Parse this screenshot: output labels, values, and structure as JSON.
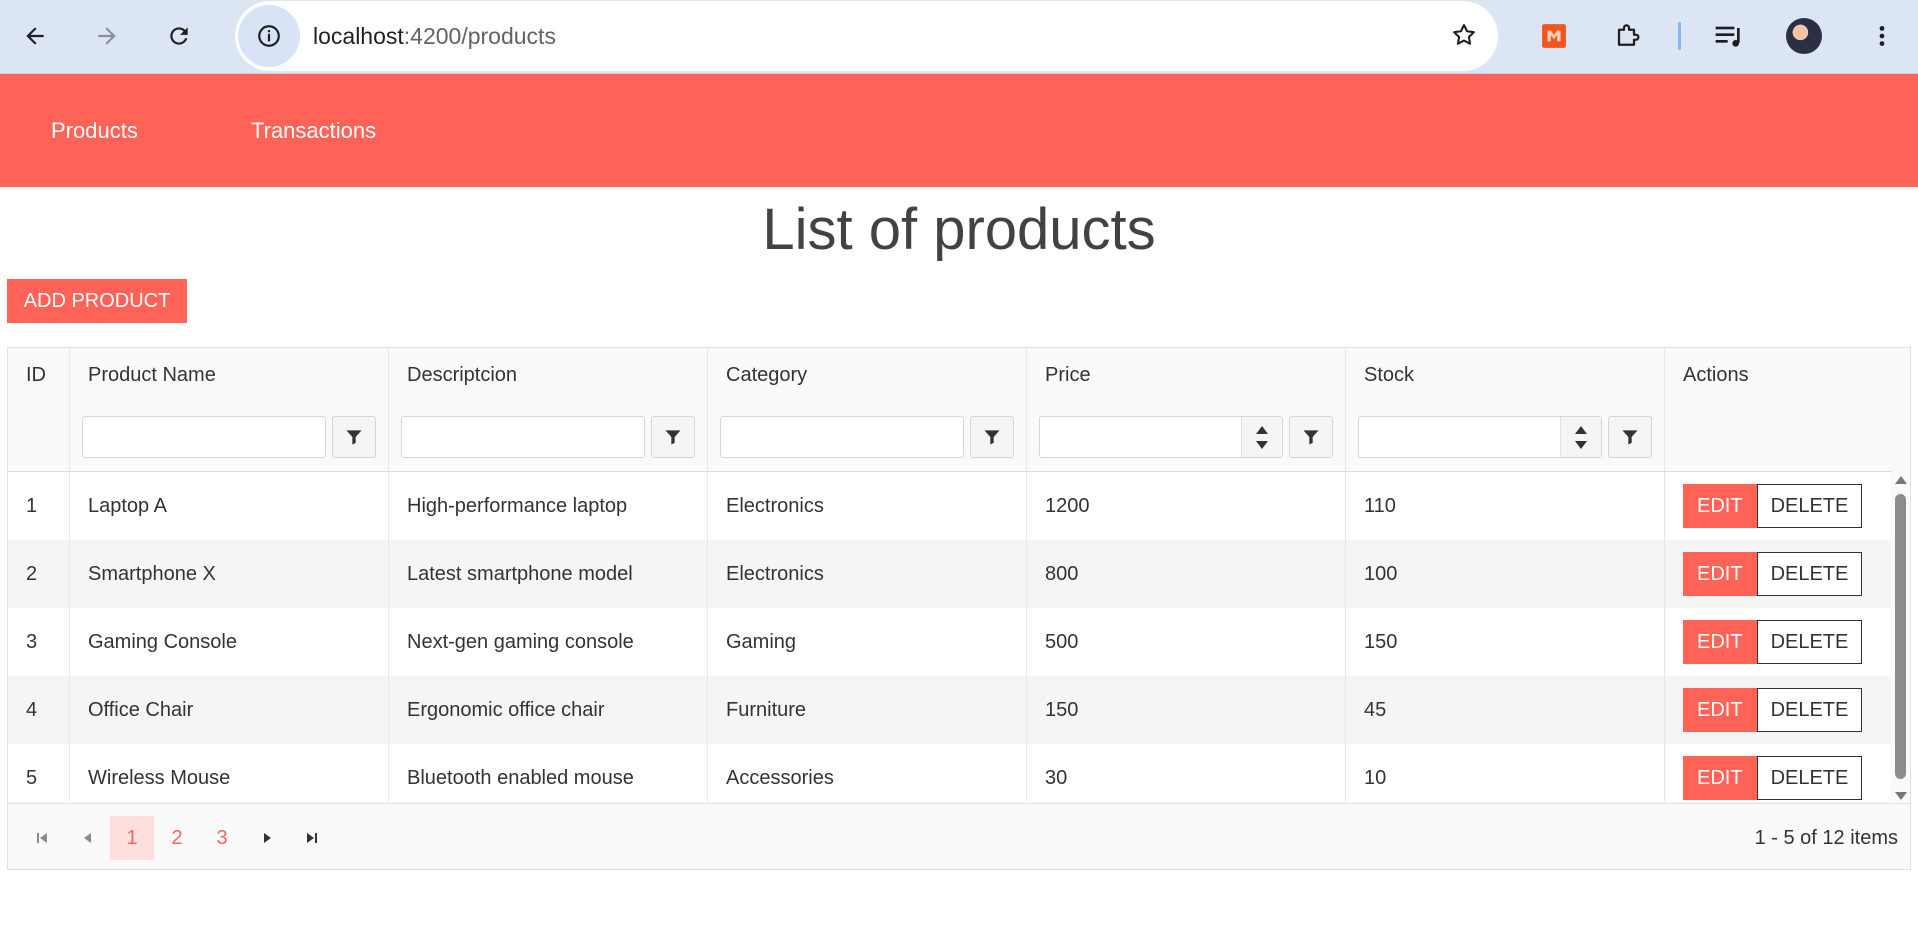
{
  "browser": {
    "url_host": "localhost",
    "url_rest": ":4200/products"
  },
  "nav": {
    "products": "Products",
    "transactions": "Transactions"
  },
  "page": {
    "title": "List of products",
    "add_button": "ADD PRODUCT"
  },
  "grid": {
    "headers": [
      "ID",
      "Product Name",
      "Descriptcion",
      "Category",
      "Price",
      "Stock",
      "Actions"
    ],
    "rows": [
      {
        "id": "1",
        "name": "Laptop A",
        "description": "High-performance laptop",
        "category": "Electronics",
        "price": "1200",
        "stock": "110"
      },
      {
        "id": "2",
        "name": "Smartphone X",
        "description": "Latest smartphone model",
        "category": "Electronics",
        "price": "800",
        "stock": "100"
      },
      {
        "id": "3",
        "name": "Gaming Console",
        "description": "Next-gen gaming console",
        "category": "Gaming",
        "price": "500",
        "stock": "150"
      },
      {
        "id": "4",
        "name": "Office Chair",
        "description": "Ergonomic office chair",
        "category": "Furniture",
        "price": "150",
        "stock": "45"
      },
      {
        "id": "5",
        "name": "Wireless Mouse",
        "description": "Bluetooth enabled mouse",
        "category": "Accessories",
        "price": "30",
        "stock": "10"
      }
    ],
    "edit_label": "EDIT",
    "delete_label": "DELETE"
  },
  "pager": {
    "pages": [
      "1",
      "2",
      "3"
    ],
    "current": "1",
    "info": "1 - 5 of 12 items"
  },
  "colors": {
    "accent": "#ff6358",
    "chrome": "#dce5f4"
  },
  "icons": [
    "back-arrow-icon",
    "forward-arrow-icon",
    "reload-icon",
    "site-info-icon",
    "star-icon",
    "extension-icon",
    "puzzle-icon",
    "media-queue-icon",
    "menu-dots-icon",
    "filter-icon",
    "spin-up-icon",
    "spin-down-icon",
    "first-page-icon",
    "prev-page-icon",
    "next-page-icon",
    "last-page-icon"
  ]
}
